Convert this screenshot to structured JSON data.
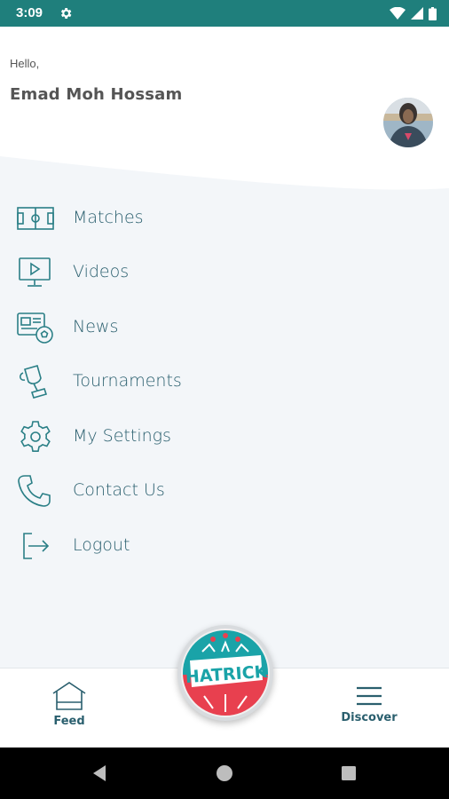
{
  "status_bar": {
    "time": "3:09"
  },
  "header": {
    "greeting": "Hello,",
    "user_name": "Emad Moh Hossam"
  },
  "menu": {
    "items": [
      {
        "label": "Matches",
        "icon": "football-pitch-icon"
      },
      {
        "label": "Videos",
        "icon": "monitor-play-icon"
      },
      {
        "label": "News",
        "icon": "news-ball-icon"
      },
      {
        "label": "Tournaments",
        "icon": "trophy-icon"
      },
      {
        "label": "My Settings",
        "icon": "gear-icon"
      },
      {
        "label": "Contact Us",
        "icon": "phone-icon"
      },
      {
        "label": "Logout",
        "icon": "logout-icon"
      }
    ]
  },
  "bottom_nav": {
    "feed_label": "Feed",
    "discover_label": "Discover",
    "logo_text": "HATRICK"
  },
  "colors": {
    "status_bar": "#1f7f7c",
    "accent": "#2a5f6e",
    "logo_teal": "#1aa3a8",
    "logo_red": "#e8404f"
  }
}
